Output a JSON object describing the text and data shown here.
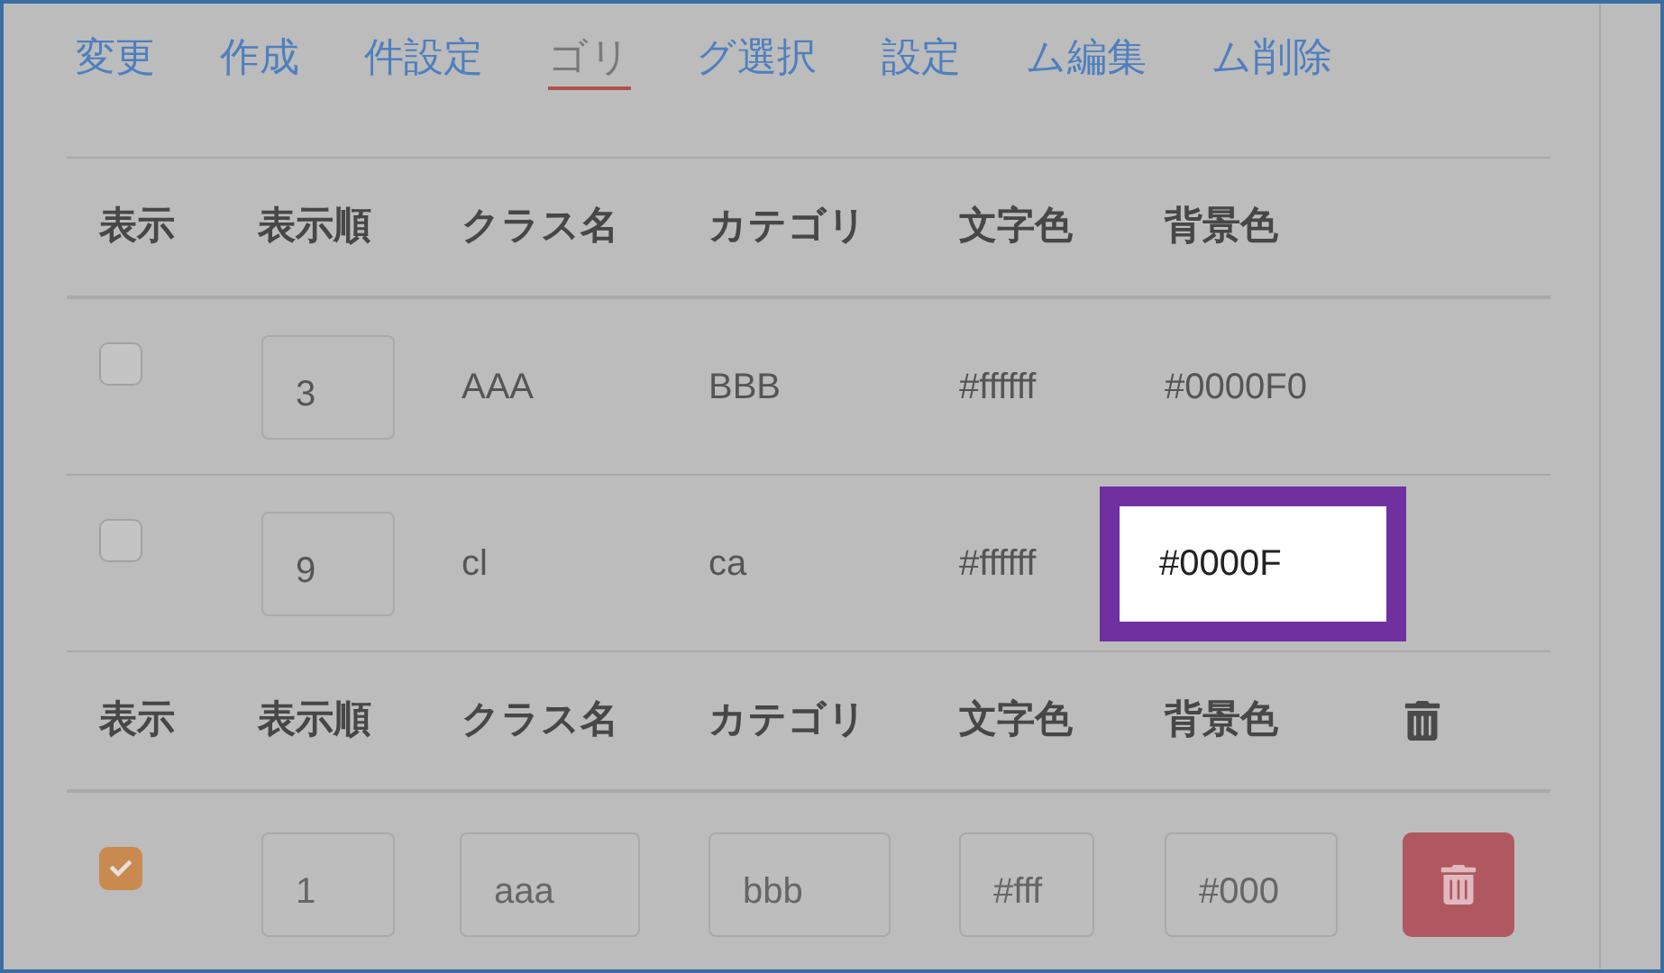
{
  "tabs": [
    {
      "label": "変更",
      "selected": false
    },
    {
      "label": "作成",
      "selected": false
    },
    {
      "label": "件設定",
      "selected": false
    },
    {
      "label": "ゴリ",
      "selected": true
    },
    {
      "label": "グ選択",
      "selected": false
    },
    {
      "label": "設定",
      "selected": false
    },
    {
      "label": "ム編集",
      "selected": false
    },
    {
      "label": "ム削除",
      "selected": false
    }
  ],
  "table": {
    "columns": [
      "表示",
      "表示順",
      "クラス名",
      "カテゴリ",
      "文字色",
      "背景色"
    ],
    "rows": [
      {
        "visible": false,
        "order": "3",
        "class_name": "AAA",
        "category": "BBB",
        "text_color": "#ffffff",
        "bg_color": "#0000F0",
        "spotlight": false
      },
      {
        "visible": false,
        "order": "9",
        "class_name": "cl",
        "category": "ca",
        "text_color": "#ffffff",
        "bg_color": "#0000F",
        "spotlight": true
      }
    ]
  },
  "edit_table": {
    "columns": [
      "表示",
      "表示順",
      "クラス名",
      "カテゴリ",
      "文字色",
      "背景色"
    ],
    "row": {
      "visible": true,
      "order": "1",
      "class_name": "aaa",
      "category": "bbb",
      "text_color": "#fff",
      "bg_color": "#000"
    }
  }
}
